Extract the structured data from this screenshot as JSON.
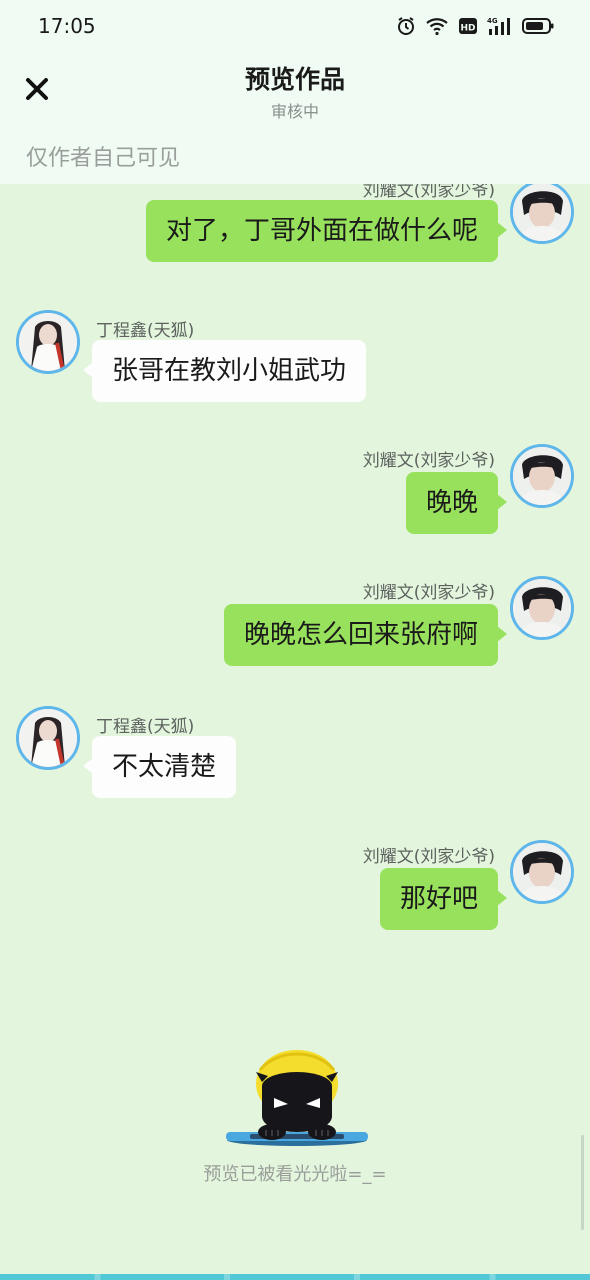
{
  "status_bar": {
    "time": "17:05",
    "icons": [
      "alarm-icon",
      "wifi-icon",
      "hd-icon",
      "4g-signal-icon",
      "battery-icon"
    ],
    "hd_label": "HD",
    "net_label": "4G"
  },
  "header": {
    "title": "预览作品",
    "subtitle": "审核中",
    "visibility": "仅作者自己可见",
    "close_icon": "close-icon"
  },
  "messages": [
    {
      "side": "right",
      "sender": "刘耀文(刘家少爷)",
      "text": "对了，丁哥外面在做什么呢"
    },
    {
      "side": "left",
      "sender": "丁程鑫(天狐)",
      "text": "张哥在教刘小姐武功"
    },
    {
      "side": "right",
      "sender": "刘耀文(刘家少爷)",
      "text": "晚晚"
    },
    {
      "side": "right",
      "sender": "刘耀文(刘家少爷)",
      "text": "晚晚怎么回来张府啊"
    },
    {
      "side": "left",
      "sender": "丁程鑫(天狐)",
      "text": "不太清楚"
    },
    {
      "side": "right",
      "sender": "刘耀文(刘家少爷)",
      "text": "那好吧"
    }
  ],
  "footer": {
    "end_text": "预览已被看光光啦=_="
  },
  "colors": {
    "background": "#e3f5dd",
    "header_bg": "#f0fcf3",
    "bubble_right": "#98e15d",
    "bubble_left": "#fcfdfc",
    "avatar_ring": "#5eb6ea"
  }
}
